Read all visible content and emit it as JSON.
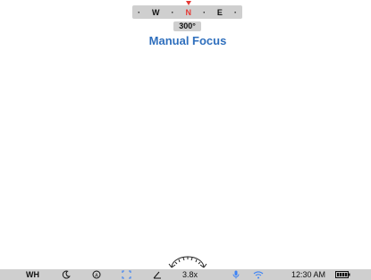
{
  "compass": {
    "dot_left": "·",
    "west": "W",
    "dot_mid_left": "·",
    "north": "N",
    "dot_mid_right": "·",
    "east": "E",
    "dot_right": "·"
  },
  "heading": "300°",
  "mode": "Manual Focus",
  "statusbar": {
    "white_balance": "WH",
    "zoom": "3.8x",
    "time": "12:30 AM",
    "icons": [
      "moon-icon",
      "auto-exposure-icon",
      "focus-frame-icon",
      "angle-icon",
      "microphone-icon",
      "wifi-icon",
      "battery-icon"
    ],
    "accent_color": "#3b82f6"
  }
}
